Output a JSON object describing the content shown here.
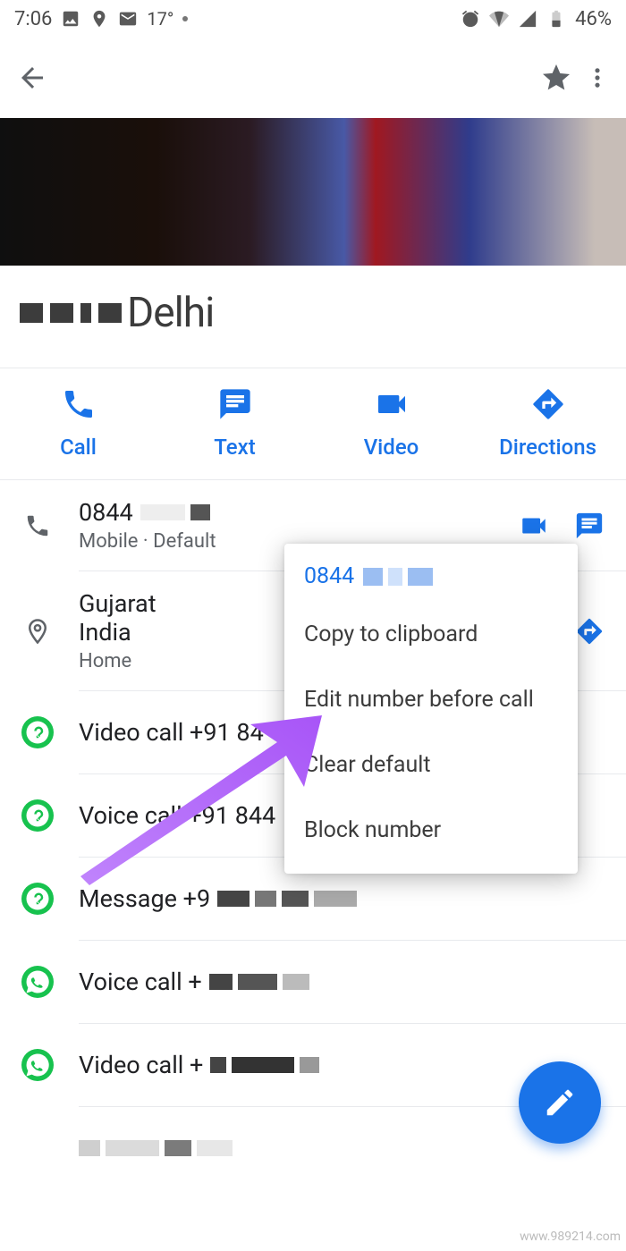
{
  "status": {
    "time": "7:06",
    "temp": "17°",
    "battery": "46%"
  },
  "contact": {
    "name_suffix": "Delhi"
  },
  "actions": {
    "call": "Call",
    "text": "Text",
    "video": "Video",
    "directions": "Directions"
  },
  "phone": {
    "number": "0844",
    "sub": "Mobile · Default"
  },
  "address": {
    "line1": "Gujarat",
    "line2": "India",
    "sub": "Home"
  },
  "links": {
    "video_call_b": "Video call +91 84",
    "voice_call_b": "Voice call +91 844",
    "message_b": "Message +9",
    "voice_call_w": "Voice call +",
    "video_call_w": "Video call +"
  },
  "popup": {
    "head": "0844",
    "copy": "Copy to clipboard",
    "edit": "Edit number before call",
    "clear": "Clear default",
    "block": "Block number"
  },
  "watermark": "www.989214.com"
}
